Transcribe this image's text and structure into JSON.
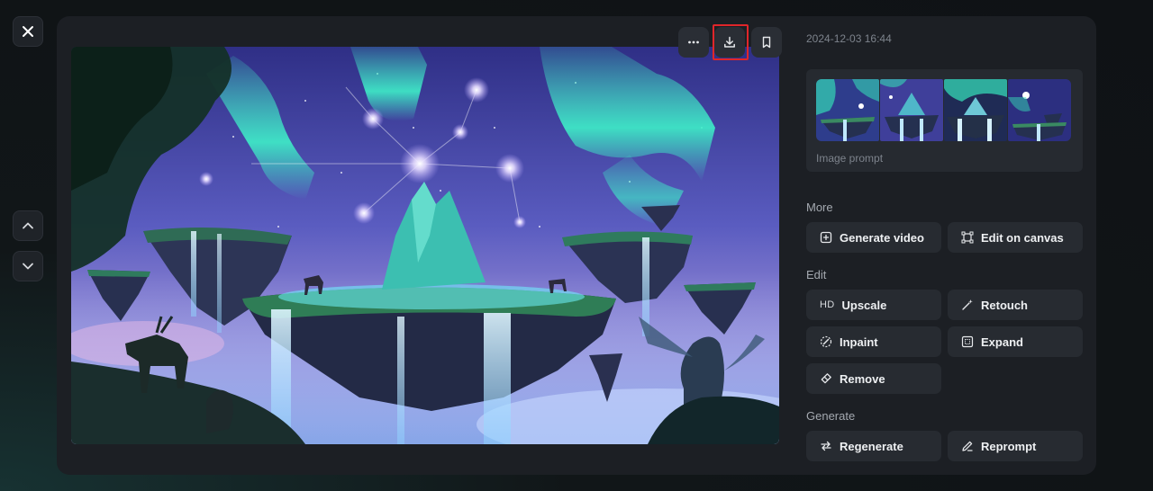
{
  "timestamp": "2024-12-03 16:44",
  "prompt_label": "Image prompt",
  "sections": {
    "more": "More",
    "edit": "Edit",
    "generate": "Generate"
  },
  "actions": {
    "generate_video": "Generate video",
    "edit_on_canvas": "Edit on canvas",
    "upscale_prefix": "HD",
    "upscale": "Upscale",
    "retouch": "Retouch",
    "inpaint": "Inpaint",
    "expand": "Expand",
    "remove": "Remove",
    "regenerate": "Regenerate",
    "reprompt": "Reprompt"
  },
  "colors": {
    "panel": "#1c1f24",
    "button": "#272b31",
    "highlight": "#e0262a",
    "aurora": "#3ef0c8",
    "sky_top": "#3b3f9e"
  },
  "icons": {
    "close": "close-icon",
    "up": "chevron-up-icon",
    "down": "chevron-down-icon",
    "more": "more-horizontal-icon",
    "download": "download-icon",
    "bookmark": "bookmark-icon"
  }
}
